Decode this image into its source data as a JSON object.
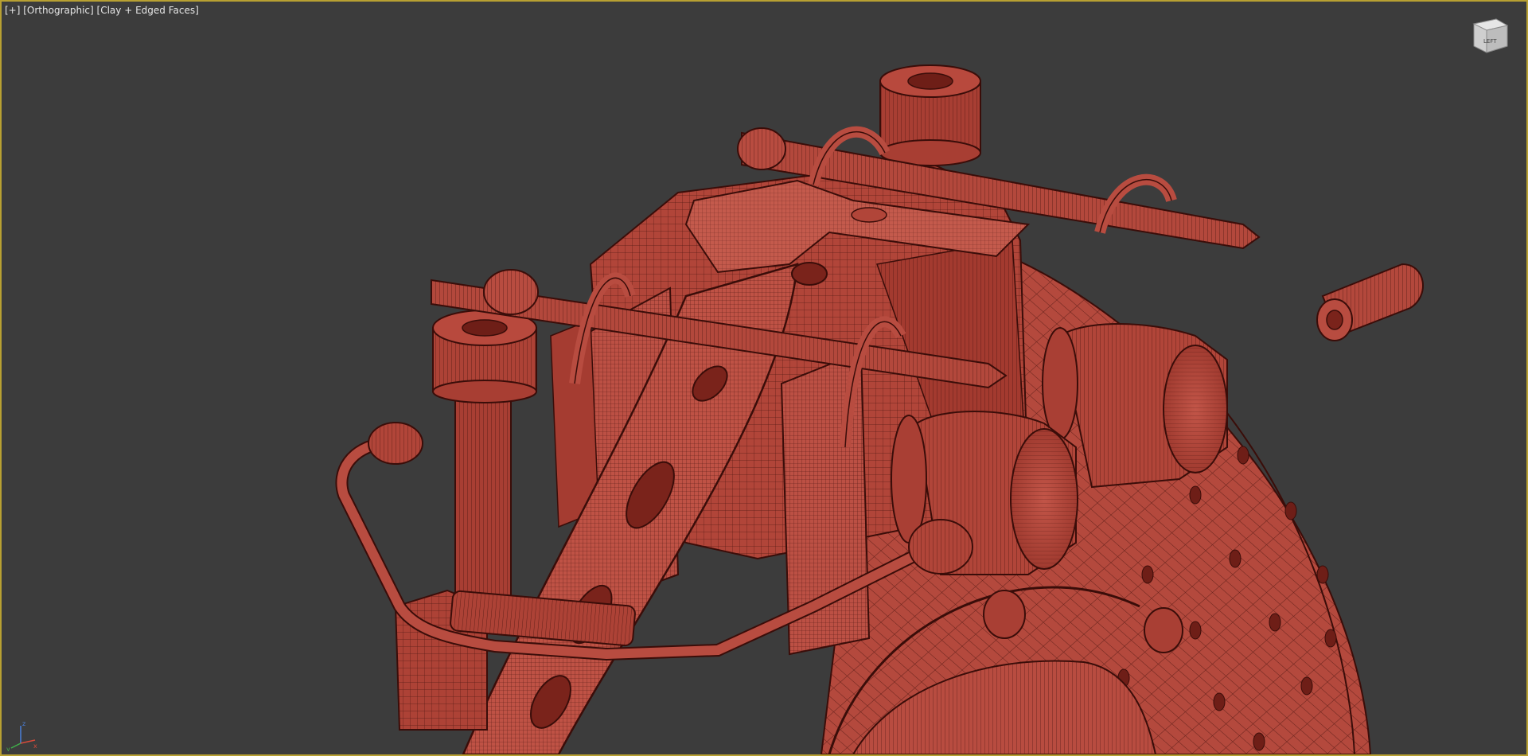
{
  "viewport": {
    "label_plus": "[+]",
    "label_view": "[Orthographic]",
    "label_shading": "[Clay + Edged Faces]",
    "border_color": "#b8a032",
    "background_color": "#3c3c3c"
  },
  "viewcube": {
    "face_label": "LEFT"
  },
  "axis_tripod": {
    "x": "x",
    "y": "y",
    "z": "z"
  },
  "model": {
    "material": "clay",
    "clay_color": "#b5463a",
    "wire_color": "#3a0d09"
  }
}
